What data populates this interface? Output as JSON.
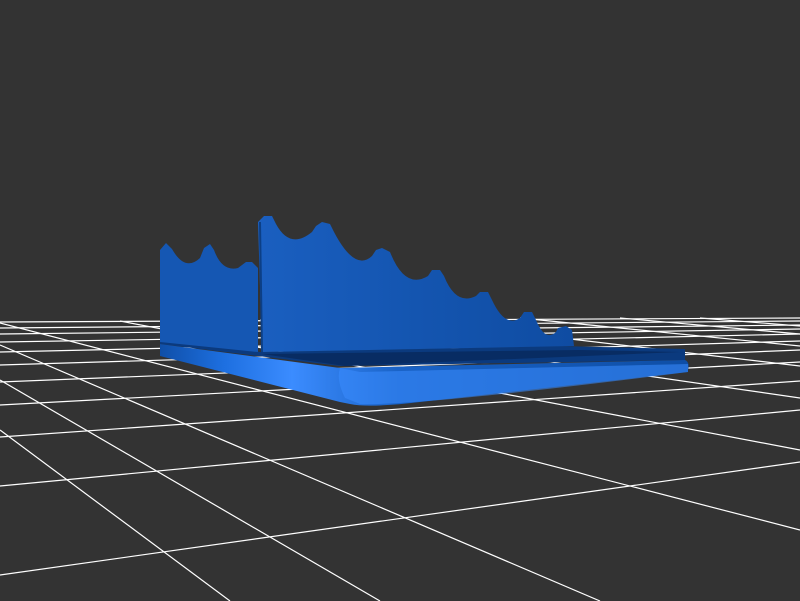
{
  "scene": {
    "background_color": "#333333",
    "grid_color": "#ffffff",
    "model_color": "#1a63c7",
    "model_shadow_color": "#0d3f88",
    "model_highlight_color": "#2f86ff",
    "object": "stepped-stand-model"
  }
}
